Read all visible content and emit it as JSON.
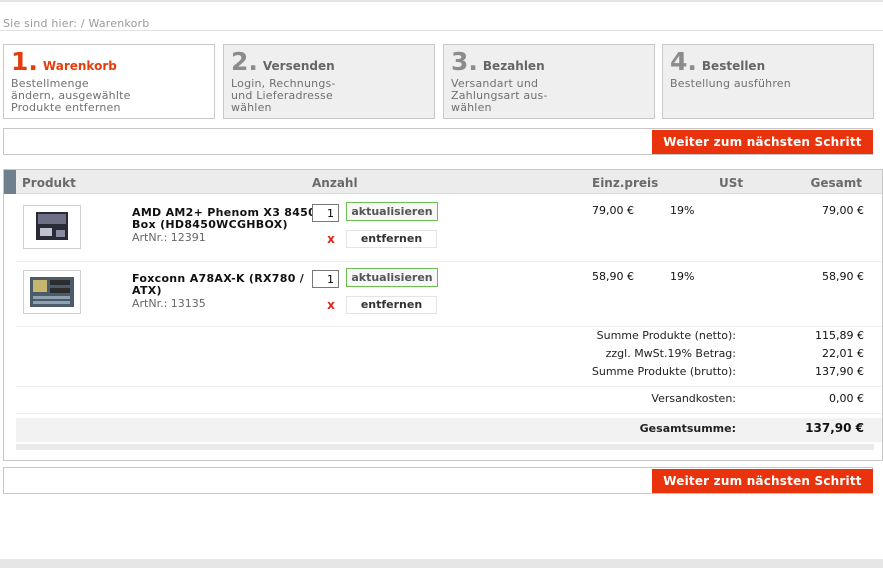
{
  "breadcrumb": "Sie sind hier: / Warenkorb",
  "steps": [
    {
      "num": "1",
      "title": "Warenkorb",
      "desc": "Bestellmenge\nändern, ausgewählte\nProdukte entfernen"
    },
    {
      "num": "2",
      "title": "Versenden",
      "desc": "Login, Rechnungs-\nund Lieferadresse\nwählen"
    },
    {
      "num": "3",
      "title": "Bezahlen",
      "desc": "Versandart und\nZahlungsart aus-\nwählen"
    },
    {
      "num": "4",
      "title": "Bestellen",
      "desc": "Bestellung ausführen"
    }
  ],
  "next_label": "Weiter zum nächsten Schritt",
  "columns": {
    "produkt": "Produkt",
    "anzahl": "Anzahl",
    "einzpreis": "Einz.preis",
    "ust": "USt",
    "gesamt": "Gesamt"
  },
  "items": [
    {
      "name": "AMD AM2+ Phenom X3 8450\nBox (HD8450WCGHBOX)",
      "art": "ArtNr.: 12391",
      "qty": "1",
      "update_label": "aktualisieren",
      "remove_x": "x",
      "remove_label": "entfernen",
      "price": "79,00 €",
      "tax": "19%",
      "total": "79,00 €"
    },
    {
      "name": "Foxconn A78AX-K (RX780 /\nATX)",
      "art": "ArtNr.: 13135",
      "qty": "1",
      "update_label": "aktualisieren",
      "remove_x": "x",
      "remove_label": "entfernen",
      "price": "58,90 €",
      "tax": "19%",
      "total": "58,90 €"
    }
  ],
  "summary": {
    "netto_label": "Summe Produkte (netto):",
    "netto": "115,89 €",
    "tax_label": "zzgl. MwSt.19% Betrag:",
    "tax": "22,01 €",
    "brutto_label": "Summe Produkte (brutto):",
    "brutto": "137,90 €",
    "shipping_label": "Versandkosten:",
    "shipping": "0,00 €",
    "total_label": "Gesamtsumme:",
    "total": "137,90 €"
  },
  "colors": {
    "accent": "#e9330c",
    "header_accent": "#6f7f8e",
    "update_border": "#6cbf4a"
  }
}
